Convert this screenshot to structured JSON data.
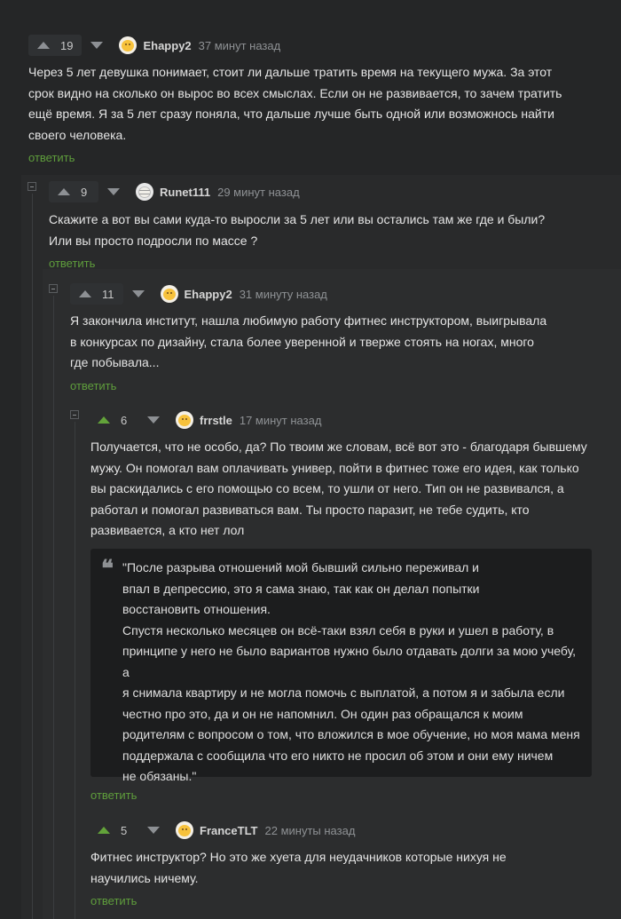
{
  "comments": [
    {
      "votes": "19",
      "author": "Ehappy2",
      "time": "37 минут назад",
      "lines": [
        "Через 5 лет девушка понимает, стоит ли дальше тратить время на текущего мужа. За этот",
        "срок видно на сколько он вырос во всех смыслах. Если он не развивается, то зачем тратить",
        "ещё время. Я за 5 лет сразу поняла, что дальше лучше быть одной или возможнось найти",
        "своего человека."
      ],
      "reply": "ответить"
    },
    {
      "votes": "9",
      "author": "Runet111",
      "time": "29 минут назад",
      "lines": [
        "Скажите а вот вы сами куда-то выросли за 5 лет или вы остались там же где и были?",
        "Или вы просто подросли по массе ?"
      ],
      "reply": "ответить"
    },
    {
      "votes": "11",
      "author": "Ehappy2",
      "time": "31 минуту назад",
      "lines": [
        "Я закончила институт, нашла любимую работу фитнес инструктором, выигрывала",
        "в конкурсах по дизайну, стала более уверенной и тверже стоять на ногах, много",
        "где побывала..."
      ],
      "reply": "ответить"
    },
    {
      "votes": "6",
      "author": "frrstle",
      "time": "17 минут назад",
      "lines": [
        "Получается, что не особо, да? По твоим же словам, всё вот это - благодаря бывшему",
        "мужу. Он помогал вам оплачивать универ, пойти в фитнес тоже его идея, как только",
        "вы раскидались с его помощью со всем, то ушли от него. Тип он не развивался, а",
        "работал и помогал развиваться вам. Ты просто паразит, не тебе судить, кто",
        "развивается, а кто нет лол"
      ],
      "quote": [
        "\"После разрыва отношений мой бывший сильно переживал и",
        "впал в депрессию, это я сама знаю, так как он делал попытки",
        "восстановить отношения.",
        "Спустя несколько месяцев он всё-таки взял себя в руки и ушел в работу, в",
        "принципе у него не было вариантов нужно было отдавать долги за мою учебу, а",
        "я снимала квартиру и не могла помочь с выплатой, а потом я и забыла если",
        "честно про это, да и он не напомнил. Он один раз обращался к моим",
        "родителям с вопросом о том, что вложился в мое обучение, но моя мама меня",
        "поддержала с сообщила что его никто не просил об этом и они ему ничем",
        "не обязаны.\""
      ],
      "reply": "ответить"
    },
    {
      "votes": "5",
      "author": "FranceTLT",
      "time": "22 минуты назад",
      "lines": [
        "Фитнес инструктор? Но это же хуета для неудачников которые нихуя не",
        "научились ничему."
      ],
      "reply": "ответить"
    }
  ],
  "colors": {
    "background": "#252627",
    "nested_panel": "#2a2b2c",
    "reply_link": "#5f9e3c",
    "upvote_green": "#63a33a",
    "quote_bg": "#1c1d1e"
  },
  "icons": [
    "upvote-icon",
    "downvote-icon",
    "avatar-icon",
    "collapse-icon",
    "quote-icon"
  ]
}
